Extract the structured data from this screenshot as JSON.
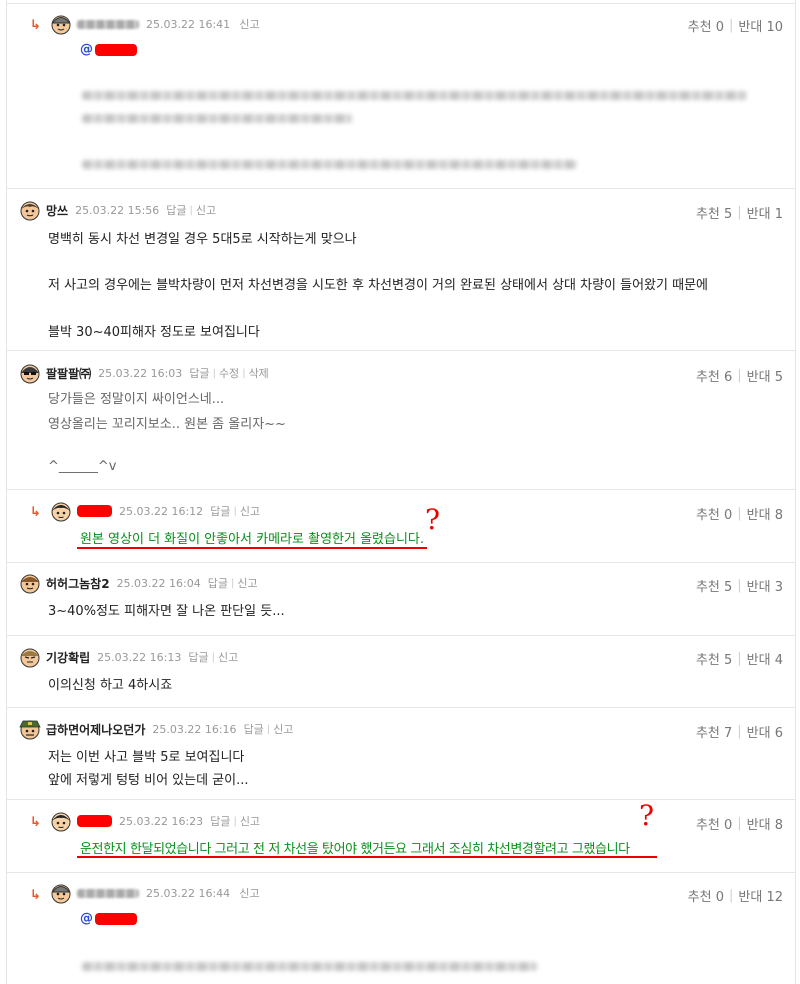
{
  "labels": {
    "reply": "답글",
    "report": "신고",
    "edit": "수정",
    "delete": "삭제",
    "mention_prefix": "@"
  },
  "comments": [
    {
      "is_reply": true,
      "nick": "",
      "time": "25.03.22 16:41",
      "up_label": "추천 0",
      "down_label": "반대 10",
      "lines": []
    },
    {
      "is_reply": false,
      "nick": "망쓰",
      "time": "25.03.22 15:56",
      "up_label": "추천 5",
      "down_label": "반대 1",
      "lines": [
        "명백히 동시 차선 변경일 경우 5대5로 시작하는게 맞으나",
        "저 사고의 경우에는 블박차량이 먼저 차선변경을 시도한 후 차선변경이 거의 완료된 상태에서 상대 차량이 들어왔기 때문에",
        "블박 30~40피해자 정도로 보여집니다"
      ]
    },
    {
      "is_reply": false,
      "nick": "팔팔팔㈜",
      "time": "25.03.22 16:03",
      "up_label": "추천 6",
      "down_label": "반대 5",
      "lines": [
        "당가들은 정말이지 싸이언스네...",
        "영상올리는 꼬리지보소.. 원본 좀 올리자~~",
        "^______^v"
      ]
    },
    {
      "is_reply": true,
      "nick": "",
      "time": "25.03.22 16:12",
      "up_label": "추천 0",
      "down_label": "반대 8",
      "lines": [
        "원본 영상이 더 화질이 안좋아서 카메라로 촬영한거 올렸습니다."
      ]
    },
    {
      "is_reply": false,
      "nick": "허허그놈참2",
      "time": "25.03.22 16:04",
      "up_label": "추천 5",
      "down_label": "반대 3",
      "lines": [
        "3~40%정도 피해자면 잘 나온 판단일 듯..."
      ]
    },
    {
      "is_reply": false,
      "nick": "기강확립",
      "time": "25.03.22 16:13",
      "up_label": "추천 5",
      "down_label": "반대 4",
      "lines": [
        "이의신청 하고 4하시죠"
      ]
    },
    {
      "is_reply": false,
      "nick": "급하면어제나오던가",
      "time": "25.03.22 16:16",
      "up_label": "추천 7",
      "down_label": "반대 6",
      "lines": [
        "저는 이번 사고 블박 5로 보여집니다",
        "앞에 저렇게 텅텅 비어 있는데 굳이..."
      ]
    },
    {
      "is_reply": true,
      "nick": "",
      "time": "25.03.22 16:23",
      "up_label": "추천 0",
      "down_label": "반대 8",
      "lines": [
        "운전한지 한달되었습니다 그러고 전 저 차선을 탔어야 했거든요 그래서 조심히 차선변경할려고 그랬습니다"
      ]
    },
    {
      "is_reply": true,
      "nick": "",
      "time": "25.03.22 16:44",
      "up_label": "추천 0",
      "down_label": "반대 12",
      "lines": []
    }
  ],
  "annotations": {
    "question_mark": "?"
  }
}
